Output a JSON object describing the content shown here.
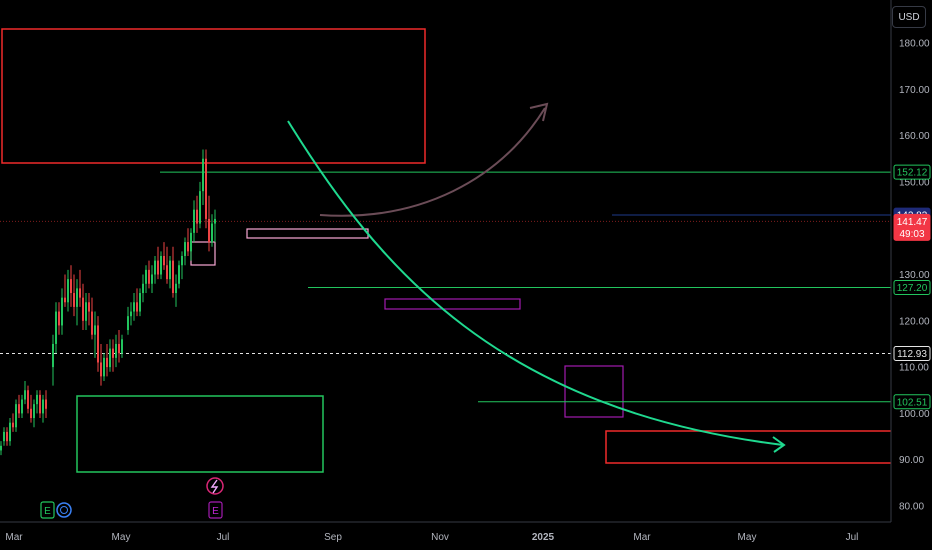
{
  "chart_data": {
    "type": "candlestick",
    "currency_button": "USD",
    "y_axis": {
      "ticks": [
        180,
        170,
        160,
        150,
        140,
        130,
        120,
        110,
        100,
        90,
        80
      ],
      "ylim": [
        76,
        188
      ]
    },
    "x_axis": {
      "ticks": [
        "Mar",
        "May",
        "Jul",
        "Sep",
        "Nov",
        "2025",
        "Mar",
        "May",
        "Jul"
      ]
    },
    "price_tags": [
      {
        "label": "152.12",
        "value": 152.12,
        "style": "green"
      },
      {
        "label": "142.83",
        "value": 142.83,
        "style": "navy"
      },
      {
        "label": "141.47",
        "value": 141.47,
        "style": "red",
        "sub": "49:03"
      },
      {
        "label": "127.20",
        "value": 127.2,
        "style": "green"
      },
      {
        "label": "112.93",
        "value": 112.93,
        "style": "white"
      },
      {
        "label": "102.51",
        "value": 102.51,
        "style": "green"
      }
    ],
    "horizontal_lines": [
      {
        "value": 152.12,
        "color": "#22c55e",
        "from": "May"
      },
      {
        "value": 127.2,
        "color": "#22c55e",
        "from": "Jul"
      },
      {
        "value": 102.51,
        "color": "#22c55e",
        "from": "Nov"
      },
      {
        "value": 112.93,
        "color": "#e5e5e5",
        "dashed": true
      },
      {
        "value": 141.47,
        "color": "#7f1d1d",
        "dotted": true
      }
    ],
    "zones": [
      {
        "name": "supply-zone",
        "color": "#ef2b2b",
        "range": [
          163,
          185
        ]
      },
      {
        "name": "demand-zone",
        "color": "#22c55e",
        "range": [
          87,
          103
        ]
      },
      {
        "name": "target-zone",
        "color": "#ef2b2b",
        "range": [
          89.5,
          96.5
        ]
      }
    ],
    "candles": [
      [
        0,
        92,
        94,
        91,
        93
      ],
      [
        3,
        94,
        97,
        93,
        96
      ],
      [
        6,
        96,
        97,
        93,
        94
      ],
      [
        9,
        94,
        99,
        93,
        98
      ],
      [
        12,
        98,
        100,
        96,
        97
      ],
      [
        15,
        97,
        103,
        96,
        102
      ],
      [
        18,
        102,
        104,
        99,
        100
      ],
      [
        21,
        100,
        104,
        99,
        103
      ],
      [
        24,
        103,
        107,
        102,
        105
      ],
      [
        27,
        105,
        106,
        100,
        101
      ],
      [
        30,
        101,
        104,
        98,
        99
      ],
      [
        33,
        99,
        103,
        97,
        102
      ],
      [
        36,
        102,
        105,
        100,
        104
      ],
      [
        39,
        104,
        105,
        99,
        100
      ],
      [
        42,
        100,
        104,
        98,
        103
      ],
      [
        45,
        103,
        105,
        99,
        101
      ],
      [
        52,
        110,
        117,
        106,
        115
      ],
      [
        55,
        115,
        124,
        113,
        122
      ],
      [
        58,
        122,
        124,
        117,
        119
      ],
      [
        61,
        119,
        127,
        117,
        125
      ],
      [
        64,
        125,
        130,
        123,
        124
      ],
      [
        67,
        124,
        131,
        122,
        129
      ],
      [
        70,
        129,
        132,
        123,
        126
      ],
      [
        73,
        126,
        130,
        121,
        123
      ],
      [
        76,
        123,
        129,
        119,
        127
      ],
      [
        79,
        127,
        131,
        123,
        125
      ],
      [
        82,
        125,
        128,
        118,
        120
      ],
      [
        85,
        120,
        126,
        118,
        124
      ],
      [
        88,
        124,
        126,
        119,
        122
      ],
      [
        91,
        122,
        125,
        116,
        117
      ],
      [
        94,
        117,
        122,
        112,
        119
      ],
      [
        97,
        119,
        121,
        109,
        111
      ],
      [
        100,
        111,
        115,
        106,
        108
      ],
      [
        103,
        108,
        113,
        107,
        112
      ],
      [
        106,
        112,
        115,
        108,
        110
      ],
      [
        109,
        110,
        116,
        109,
        114
      ],
      [
        112,
        114,
        116,
        109,
        112
      ],
      [
        115,
        112,
        117,
        110,
        115
      ],
      [
        118,
        115,
        118,
        111,
        113
      ],
      [
        121,
        113,
        117,
        112,
        116
      ],
      [
        127,
        118,
        123,
        117,
        121
      ],
      [
        130,
        121,
        124,
        119,
        122
      ],
      [
        133,
        122,
        126,
        120,
        124
      ],
      [
        136,
        124,
        127,
        121,
        122
      ],
      [
        139,
        122,
        127,
        121,
        126
      ],
      [
        142,
        126,
        130,
        124,
        128
      ],
      [
        145,
        128,
        132,
        126,
        131
      ],
      [
        148,
        131,
        133,
        127,
        128
      ],
      [
        151,
        128,
        132,
        126,
        130
      ],
      [
        154,
        130,
        134,
        128,
        133
      ],
      [
        157,
        133,
        136,
        129,
        130
      ],
      [
        160,
        130,
        135,
        129,
        134
      ],
      [
        163,
        134,
        137,
        131,
        132
      ],
      [
        166,
        132,
        136,
        128,
        129
      ],
      [
        169,
        129,
        134,
        127,
        133
      ],
      [
        172,
        133,
        136,
        125,
        126
      ],
      [
        175,
        126,
        130,
        123,
        128
      ],
      [
        178,
        128,
        133,
        127,
        132
      ],
      [
        181,
        132,
        135,
        129,
        134
      ],
      [
        184,
        134,
        138,
        132,
        137
      ],
      [
        187,
        137,
        140,
        134,
        135
      ],
      [
        190,
        135,
        140,
        133,
        139
      ],
      [
        193,
        139,
        146,
        137,
        144
      ],
      [
        196,
        144,
        147,
        139,
        141
      ],
      [
        199,
        141,
        150,
        140,
        148
      ],
      [
        202,
        148,
        157,
        145,
        155
      ],
      [
        205,
        155,
        157,
        140,
        142
      ],
      [
        208,
        142,
        147,
        135,
        137
      ],
      [
        211,
        137,
        143,
        136,
        141
      ],
      [
        214,
        141,
        144,
        137,
        142
      ]
    ]
  }
}
